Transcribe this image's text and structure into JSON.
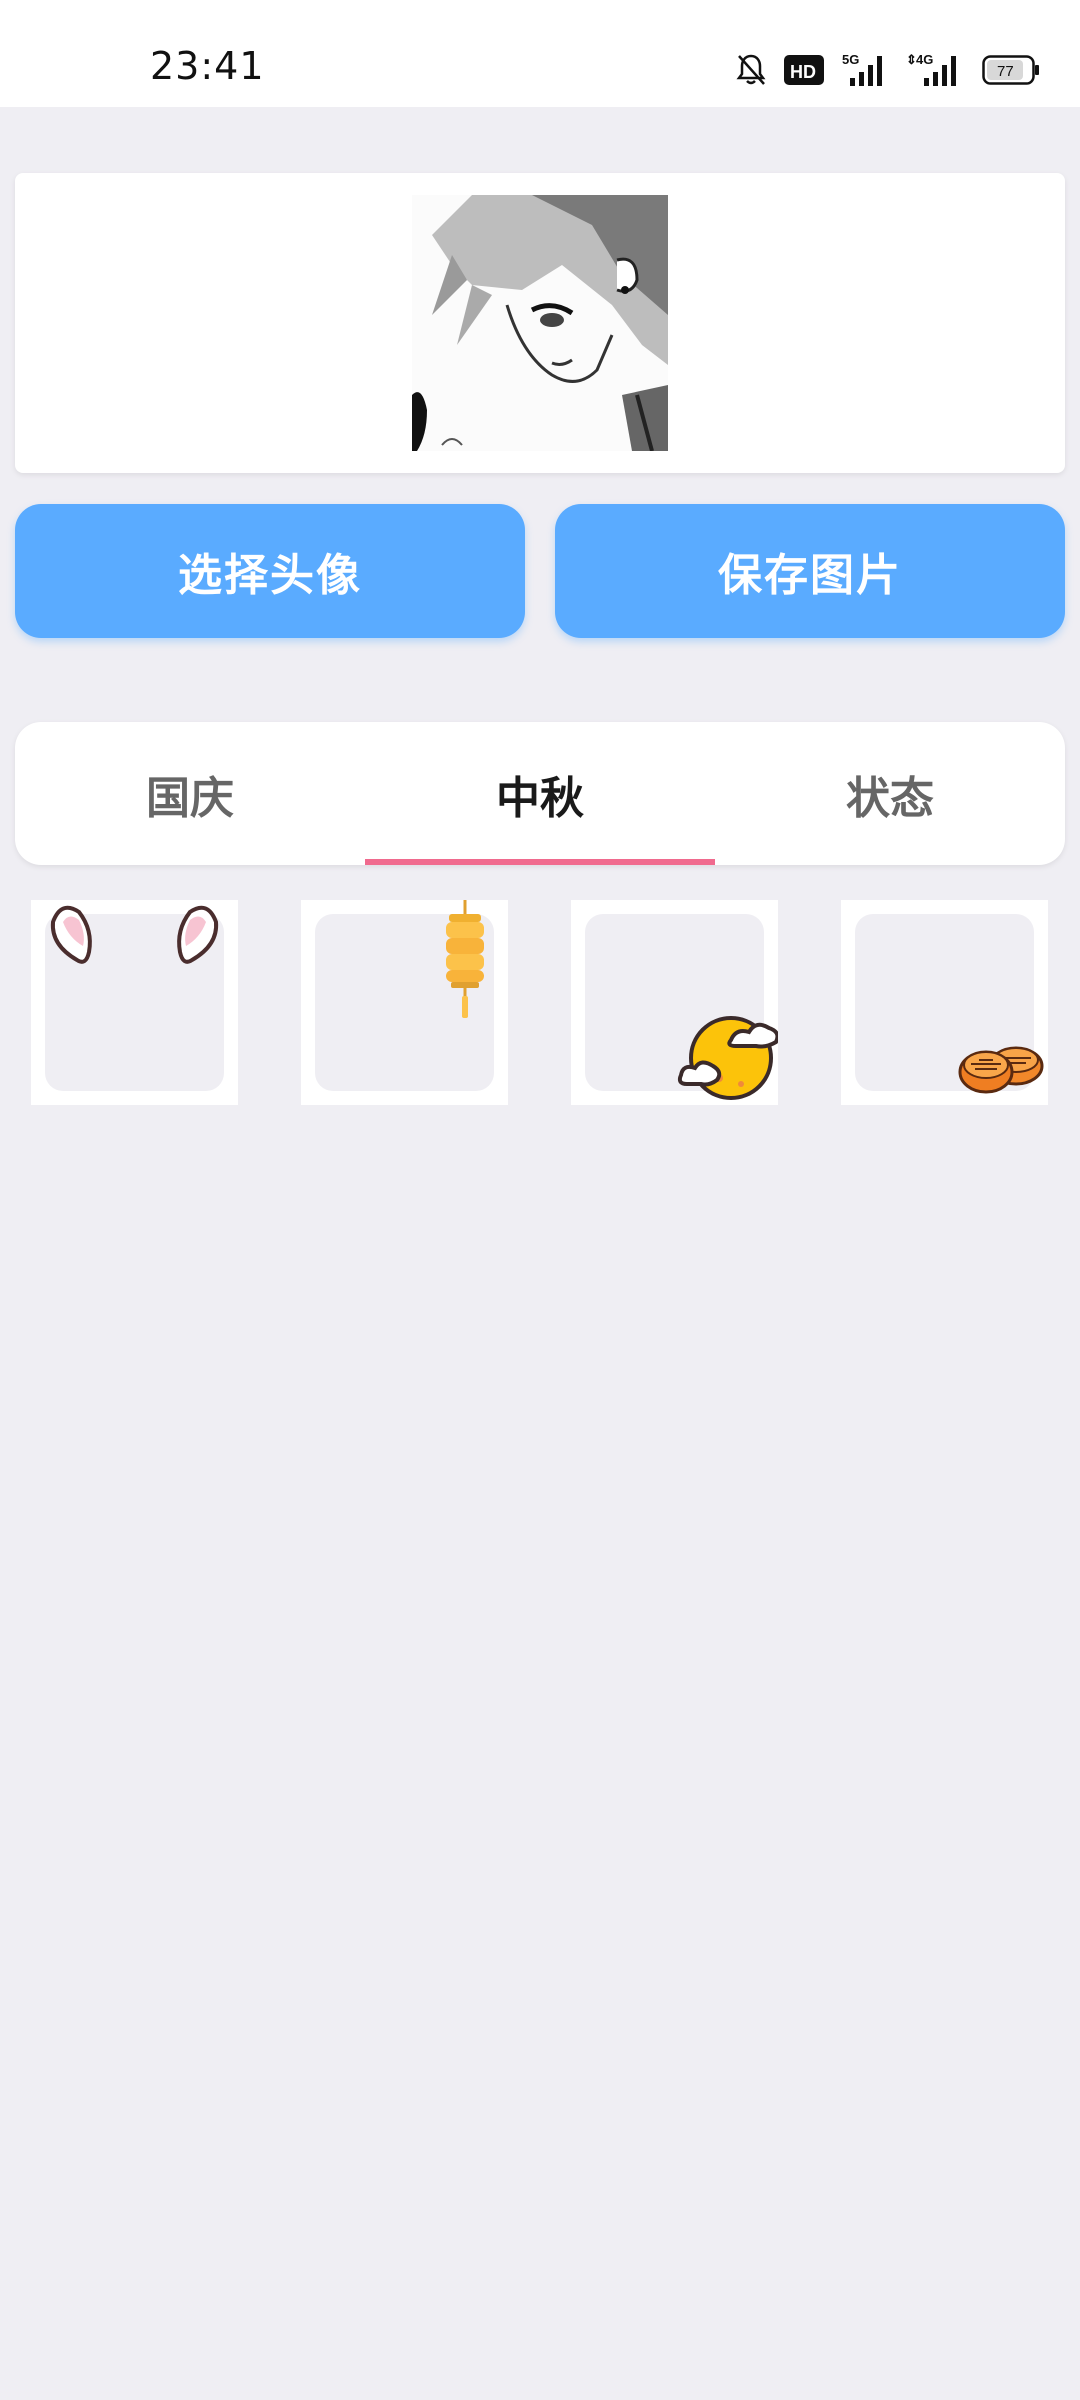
{
  "status_bar": {
    "time": "23:41",
    "icons": [
      "bell-off-icon",
      "hd-icon",
      "signal-5g-icon",
      "signal-4g-icon",
      "battery-icon"
    ],
    "hd_label": "HD",
    "net1": "5G",
    "net2": "4G",
    "battery": "77"
  },
  "preview": {
    "avatar_icon": "anime-avatar-image"
  },
  "actions": {
    "choose_label": "选择头像",
    "save_label": "保存图片"
  },
  "tabs": [
    {
      "label": "国庆",
      "active": false
    },
    {
      "label": "中秋",
      "active": true
    },
    {
      "label": "状态",
      "active": false
    }
  ],
  "frames": [
    {
      "icon": "rabbit-ears-icon"
    },
    {
      "icon": "lantern-icon"
    },
    {
      "icon": "moon-cloud-icon"
    },
    {
      "icon": "mooncake-icon"
    }
  ],
  "colors": {
    "accent": "#5aabff",
    "indicator": "#f06a8e",
    "background": "#efeef3"
  }
}
